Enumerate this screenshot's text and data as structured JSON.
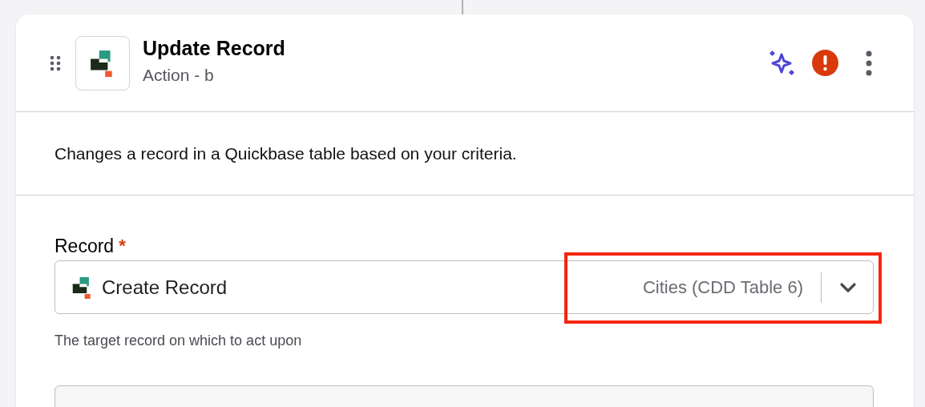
{
  "step": {
    "title": "Update Record",
    "subtitle": "Action - b",
    "has_error": true
  },
  "description": "Changes a record in a Quickbase table based on your criteria.",
  "fields": [
    {
      "label": "Record",
      "required_mark": "*",
      "value": "Create Record",
      "table": "Cities (CDD Table 6)",
      "help": "The target record on which to act upon",
      "highlighted": true
    }
  ]
}
